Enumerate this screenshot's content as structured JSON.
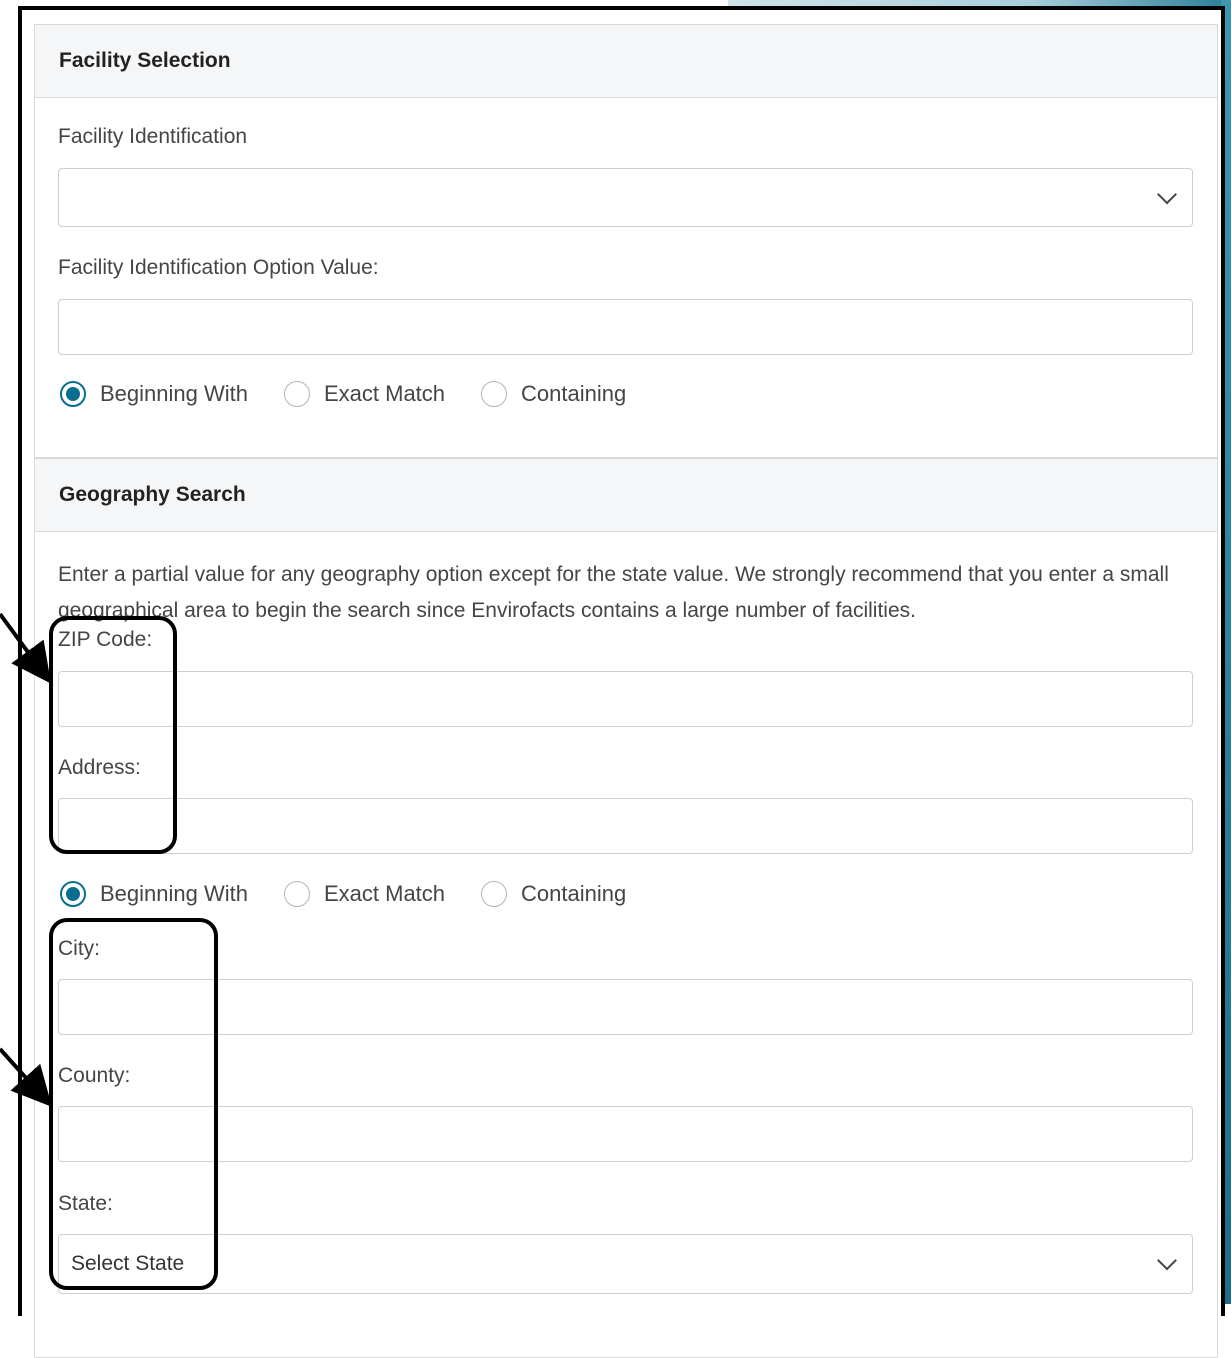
{
  "facility": {
    "title": "Facility Selection",
    "identification_label": "Facility Identification",
    "identification_value": "",
    "option_value_label": "Facility Identification Option Value:",
    "option_value": "",
    "match_options": [
      "Beginning With",
      "Exact Match",
      "Containing"
    ],
    "selected_match": "Beginning With"
  },
  "geography": {
    "title": "Geography Search",
    "help_text": "Enter a partial value for any geography option except for the state value. We strongly recommend that you enter a small geographical area to begin the search since Envirofacts contains a large number of facilities.",
    "zip_label": "ZIP Code:",
    "zip_value": "",
    "address_label": "Address:",
    "address_value": "",
    "match_options": [
      "Beginning With",
      "Exact Match",
      "Containing"
    ],
    "selected_match": "Beginning With",
    "city_label": "City:",
    "city_value": "",
    "county_label": "County:",
    "county_value": "",
    "state_label": "State:",
    "state_value": "Select State"
  },
  "colors": {
    "accent": "#0a6f8f",
    "border": "#cfcfcf",
    "header_bg": "#f5f6f7"
  }
}
